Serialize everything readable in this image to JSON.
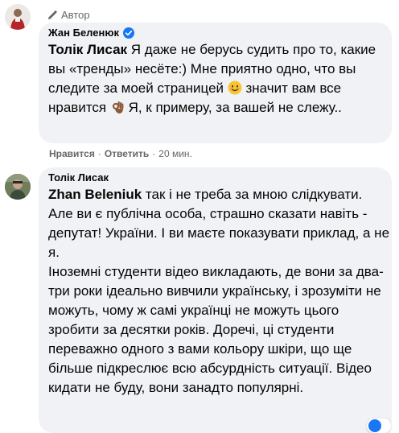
{
  "comment1": {
    "badge": "Автор",
    "name": "Жан Беленюк",
    "mention": "Толік Лисак",
    "text_a": " Я даже не берусь судить про то, какие вы «тренды» несёте:) Мне приятно одно, что вы следите за моей страницей ",
    "text_b": " значит вам все нравится ",
    "text_c": " Я, к примеру, за вашей не слежу..",
    "like_label": "Нравится",
    "reply_label": "Ответить",
    "time": "20 мин.",
    "separator": "·"
  },
  "comment2": {
    "name": "Толік Лисак",
    "mention": "Zhan Beleniuk",
    "text_a": " так і не треба за мною слідкувати. Але ви є публічна особа, страшно сказати навіть - депутат! України. І ви маєте показувати приклад, а не я.",
    "text_b": "Іноземні студенти відео викладають, де вони за два-три роки ідеально вивчили українську, і зрозуміти не можуть, чому ж самі українці не можуть цього зробити за десятки років. Доречі, ці студенти переважно одного з вами кольору шкіри, що ще більше підкреслює всю абсурдність ситуації. Відео кидати не буду, вони занадто популярні."
  },
  "icons": {
    "author_badge": "pencil-icon",
    "verified": "verified-badge-icon",
    "emoji_smile": "smiling-face-icon",
    "emoji_ok": "ok-hand-icon"
  },
  "colors": {
    "bubble": "#f0f2f5",
    "verified": "#1877f2",
    "meta": "#65676b"
  }
}
